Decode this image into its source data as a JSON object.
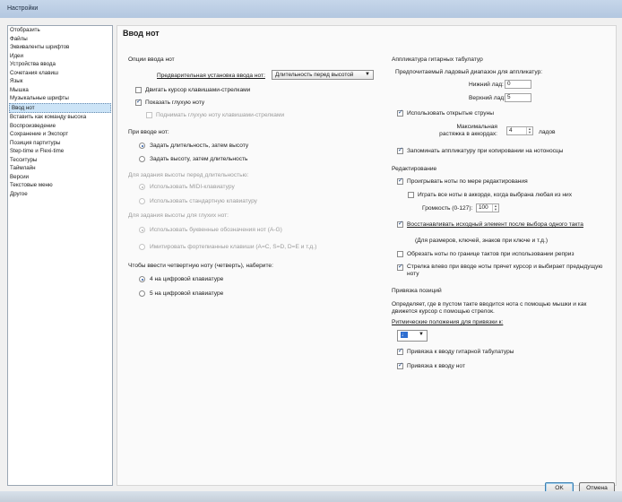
{
  "window": {
    "title": "Настройки"
  },
  "sidebar": {
    "items": [
      {
        "label": "Отобразить"
      },
      {
        "label": "Файлы"
      },
      {
        "label": "Эквиваленты шрифтов"
      },
      {
        "label": "Идеи"
      },
      {
        "label": "Устройства ввода"
      },
      {
        "label": "Сочетания клавиш"
      },
      {
        "label": "Язык"
      },
      {
        "label": "Мышка"
      },
      {
        "label": "Музыкальные шрифты"
      },
      {
        "label": "Ввод нот"
      },
      {
        "label": "Вставить как команду высоха"
      },
      {
        "label": "Воспроизведение"
      },
      {
        "label": "Сохранение и Экспорт"
      },
      {
        "label": "Позиция партитуры"
      },
      {
        "label": "Step-time и Flexi-time"
      },
      {
        "label": "Тесситуры"
      },
      {
        "label": "Таймлайн"
      },
      {
        "label": "Версии"
      },
      {
        "label": "Текстовые меню"
      },
      {
        "label": "Другое"
      }
    ],
    "selected_index": 9
  },
  "page": {
    "title": "Ввод нот"
  },
  "left": {
    "options_heading": "Опции ввода нот",
    "preset_label": "Предварительная установка ввода нот:",
    "preset_value": "Длительность перед высотой",
    "move_cursor_arrows": "Двигать курсор клавишами-стрелками",
    "show_ghost_note": "Показать глухую ноту",
    "ghost_note_up_down": "Поднимать глухую ноту клавишами-стрелками",
    "pitch_entry_heading": "При вводе нот:",
    "duration_then_pitch": "Задать длительность, затем высоту",
    "pitch_then_duration": "Задать высоту, затем длительность",
    "duration_first_heading": "Для задания высоты перед длительностью:",
    "use_midi_keyboard": "Использовать MIDI-клавиатуру",
    "use_computer_keyboard": "Использовать стандартную клавиатуру",
    "ghost_note_heading": "Для задания высоты для глухих нот:",
    "use_letter_names": "Использовать буквенные обозначения нот (A-G)",
    "piano_keys_emulation": "Имитировать фортепианные клавиши (A=C, S=D, D=E и т.д.)",
    "quarter_note_heading": "Чтобы ввести четвертную ноту (четверть), наберите:",
    "numpad_4": "4 на цифровой клавиатуре",
    "numpad_5": "5 на цифровой клавиатуре"
  },
  "right": {
    "tab_heading": "Аппликатура гитарных табулатур",
    "fret_range_label": "Предпочитаемый ладовый диапазон для аппликатур:",
    "lower_fret_label": "Нижний лад:",
    "lower_fret_value": "0",
    "upper_fret_label": "Верхний лад:",
    "upper_fret_value": "5",
    "use_open_strings": "Использовать открытые струны",
    "max_stretch_label": "Максимальная растяжка в аккордах:",
    "max_stretch_value": "4",
    "max_stretch_unit": "ладов",
    "remember_fingering": "Запоминать аппликатуру при копировании на нотоносцы",
    "editing_heading": "Редактирование",
    "play_notes_on_edit": "Проигрывать ноты по мере редактирования",
    "play_all_in_chord": "Играть все ноты в аккорде, когда выбрана любая из них",
    "volume_label": "Громкость (0-127):",
    "volume_value": "100",
    "restore_previous": "Восстанавливать исходный элемент после выбора одного такта",
    "restore_note": "(Для размеров, ключей, знаков при ключе и т.д.)",
    "trim_at_repeats": "Обрезать ноты по границе тактов при использовании реприз",
    "left_arrow_moves": "Стрелка влево при вводе ноты прячет курсор и выбирает предыдущую ноту",
    "snap_heading": "Привязка позиций",
    "snap_desc": "Определяет, где в пустом такте вводится нота с помощью мышки и как движется курсор с помощью стрелок.",
    "rhythmic_snap_label": "Ритмические положения для привязки к:",
    "snap_value": "♩",
    "snap_to_tab": "Привязка к вводу гитарной табулатуры",
    "snap_to_notes": "Привязка к вводу нот"
  },
  "buttons": {
    "ok": "OK",
    "cancel": "Отмена"
  },
  "colors": {
    "titlebar": "#b9cce4",
    "selection": "#cce4f7",
    "accent": "#2b5ea8"
  }
}
